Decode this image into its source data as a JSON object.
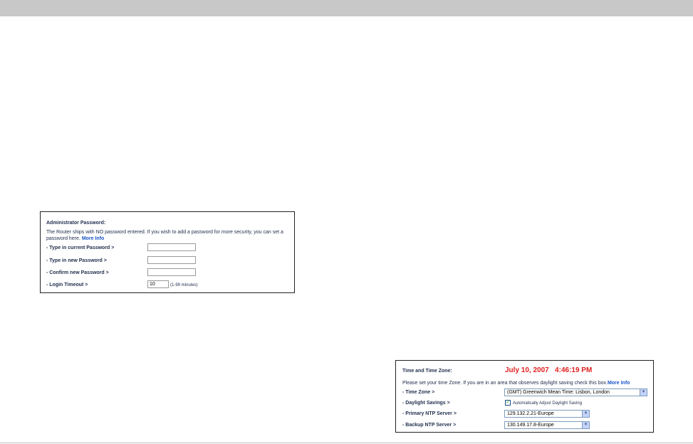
{
  "admin_password": {
    "title": "Administrator Password:",
    "description": "The Router ships with NO password entered. If you wish to add a password for more security, you can set a password here.",
    "more_info": "More Info",
    "fields": [
      {
        "label": "- Type in current Password >",
        "value": ""
      },
      {
        "label": "- Type in new Password >",
        "value": ""
      },
      {
        "label": "- Confirm new Password >",
        "value": ""
      }
    ],
    "login_timeout": {
      "label": "- Login Timeout >",
      "value": "10",
      "hint": "(1-99 minutes)"
    }
  },
  "time_zone": {
    "title": "Time and Time Zone:",
    "current_time": "July 10, 2007   4:46:19 PM",
    "description": "Please set your time Zone. If you are in an area that observes daylight saving check this box.",
    "more_info": "More Info",
    "time_zone_label": "- Time Zone >",
    "time_zone_value": "(GMT) Greenwich Mean Time: Lisbon, London",
    "daylight_label": "- Daylight Savings >",
    "daylight_checkbox_label": "Automatically Adjust Daylight Saving",
    "daylight_checked": true,
    "primary_ntp_label": "- Primary NTP Server >",
    "primary_ntp_value": "129.132.2.21-Europe",
    "backup_ntp_label": "- Backup NTP Server >",
    "backup_ntp_value": "130.149.17.8-Europe"
  },
  "colors": {
    "accent_link": "#1a55c8",
    "time_red": "#e02020",
    "header_bar": "#c8c8c8"
  }
}
